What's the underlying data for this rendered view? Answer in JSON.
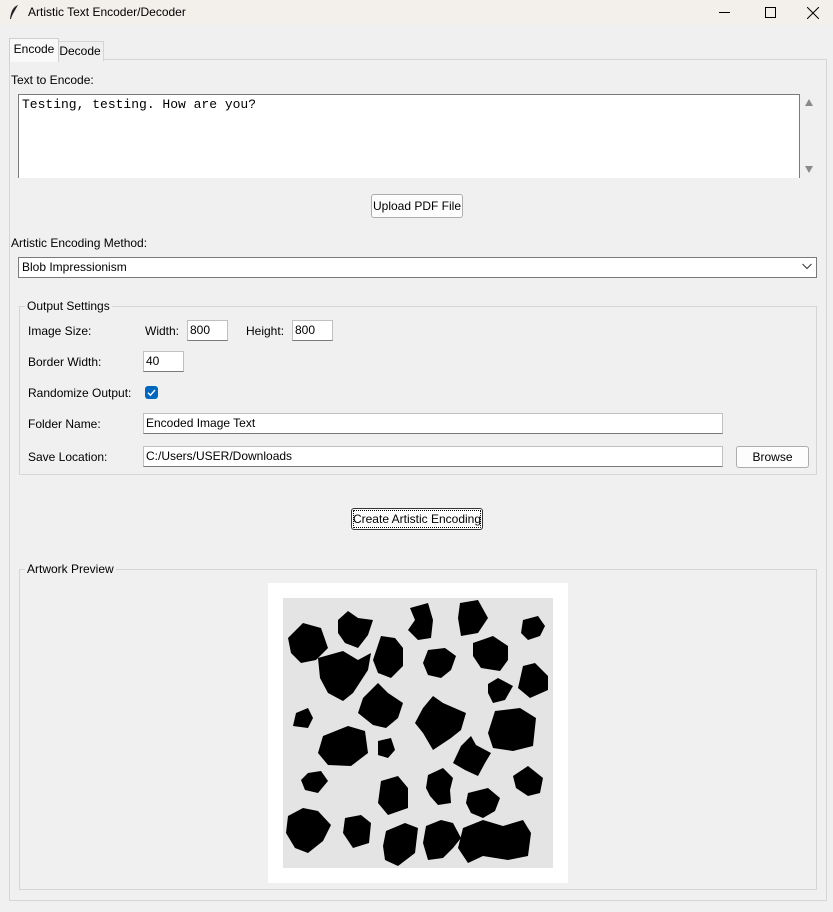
{
  "window": {
    "title": "Artistic Text Encoder/Decoder",
    "controls": {
      "minimize": "—",
      "maximize": "☐",
      "close": "✕"
    }
  },
  "tabs": {
    "encode": "Encode",
    "decode": "Decode",
    "active": "Encode"
  },
  "encode": {
    "text_label": "Text to Encode:",
    "text_value": "Testing, testing. How are you?",
    "upload_button": "Upload PDF File",
    "method_label": "Artistic Encoding Method:",
    "method_value": "Blob Impressionism"
  },
  "output_settings": {
    "title": "Output Settings",
    "image_size_label": "Image Size:",
    "width_label": "Width:",
    "width_value": "800",
    "height_label": "Height:",
    "height_value": "800",
    "border_label": "Border Width:",
    "border_value": "40",
    "randomize_label": "Randomize Output:",
    "randomize_checked": true,
    "folder_label": "Folder Name:",
    "folder_value": "Encoded Image Text",
    "save_label": "Save Location:",
    "save_value": "C:/Users/USER/Downloads",
    "browse_button": "Browse"
  },
  "create_button": "Create Artistic Encoding",
  "preview": {
    "title": "Artwork Preview"
  },
  "colors": {
    "accent": "#0067c0",
    "background": "#f0f0f0",
    "artwork_bg": "#e4e4e4",
    "blob": "#000000"
  },
  "icons": {
    "app": "feather-icon",
    "dropdown": "chevron-down-icon",
    "check": "checkmark-icon"
  }
}
